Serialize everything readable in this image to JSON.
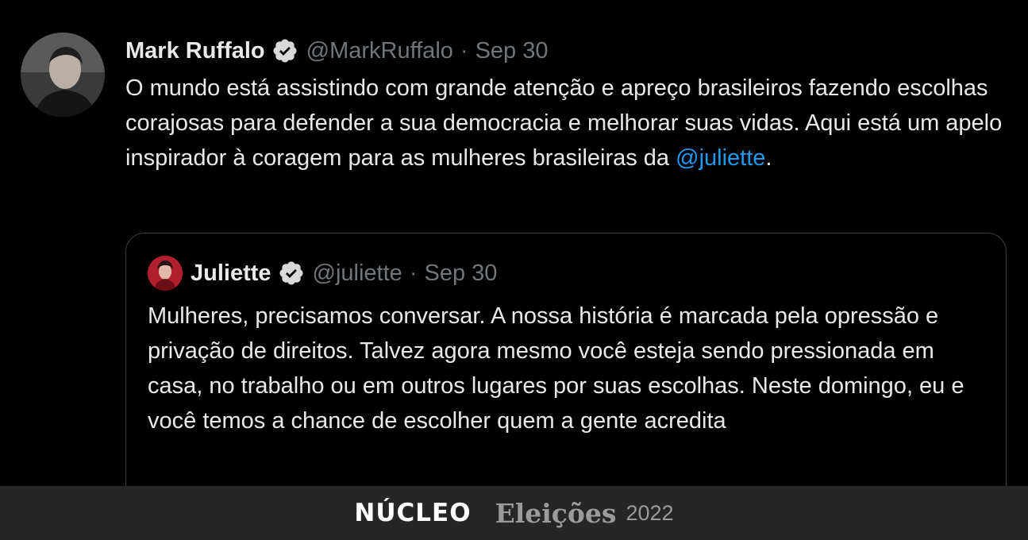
{
  "tweet": {
    "author_name": "Mark Ruffalo",
    "handle": "@MarkRuffalo",
    "separator": "·",
    "date": "Sep 30",
    "text_main": "O mundo está assistindo com grande atenção e apreço brasileiros fazendo escolhas corajosas para defender a sua democracia e melhorar suas vidas. Aqui está um apelo inspirador à coragem para as mulheres brasileiras da ",
    "mention": "@juliette",
    "text_end": ".",
    "avatar_icon": "portrait-photo",
    "verified_icon": "verified-badge-icon"
  },
  "quote": {
    "author_name": "Juliette",
    "handle": "@juliette",
    "separator": "·",
    "date": "Sep 30",
    "text": "Mulheres, precisamos conversar. A nossa história é marcada pela opressão e privação de direitos. Talvez agora mesmo você esteja sendo pressionada em casa, no trabalho ou em outros lugares por suas escolhas. Neste domingo, eu e você temos a chance de escolher quem a gente acredita",
    "avatar_icon": "portrait-photo",
    "verified_icon": "verified-badge-icon"
  },
  "footer": {
    "brand": "NÚCLEO",
    "section": "Eleições",
    "year": "2022"
  },
  "colors": {
    "background": "#000000",
    "text": "#e7e9ea",
    "muted": "#71767b",
    "link": "#1d9bf0",
    "footer_bg": "#262626"
  }
}
